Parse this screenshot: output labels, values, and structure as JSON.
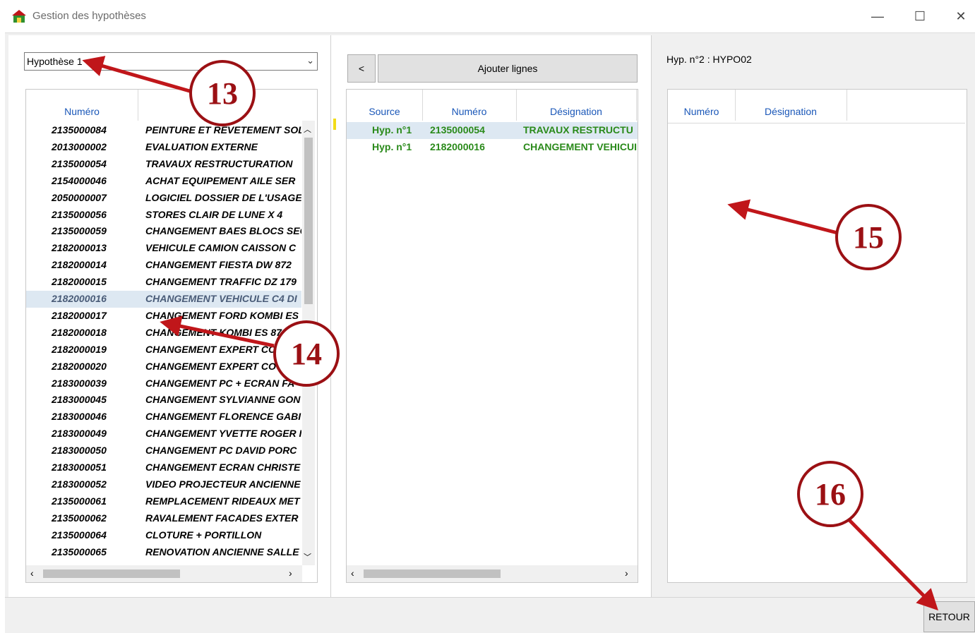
{
  "window": {
    "title": "Gestion des hypothèses",
    "minimize": "—",
    "maximize": "☐",
    "close": "✕"
  },
  "left": {
    "combo_value": "Hypothèse 1",
    "columns": [
      "Numéro",
      ""
    ],
    "rows": [
      [
        "2135000084",
        "PEINTURE ET REVETEMENT SOL"
      ],
      [
        "2013000002",
        "EVALUATION EXTERNE"
      ],
      [
        "2135000054",
        "TRAVAUX RESTRUCTURATION"
      ],
      [
        "2154000046",
        "ACHAT EQUIPEMENT AILE SER"
      ],
      [
        "2050000007",
        "LOGICIEL DOSSIER DE L'USAGE"
      ],
      [
        "2135000056",
        "STORES CLAIR DE LUNE X 4"
      ],
      [
        "2135000059",
        "CHANGEMENT BAES BLOCS SEC"
      ],
      [
        "2182000013",
        "VEHICULE CAMION CAISSON C"
      ],
      [
        "2182000014",
        "CHANGEMENT FIESTA DW 872"
      ],
      [
        "2182000015",
        "CHANGEMENT TRAFFIC DZ 179"
      ],
      [
        "2182000016",
        "CHANGEMENT VEHICULE C4 DI"
      ],
      [
        "2182000017",
        "CHANGEMENT FORD KOMBI ES"
      ],
      [
        "2182000018",
        "CHANGEMENT KOMBI ES 87"
      ],
      [
        "2182000019",
        "CHANGEMENT EXPERT CO"
      ],
      [
        "2182000020",
        "CHANGEMENT EXPERT CO"
      ],
      [
        "2183000039",
        "CHANGEMENT PC + ECRAN FA"
      ],
      [
        "2183000045",
        "CHANGEMENT SYLVIANNE GON"
      ],
      [
        "2183000046",
        "CHANGEMENT FLORENCE GABI"
      ],
      [
        "2183000049",
        "CHANGEMENT YVETTE ROGER I"
      ],
      [
        "2183000050",
        "CHANGEMENT PC DAVID PORC"
      ],
      [
        "2183000051",
        "CHANGEMENT ECRAN CHRISTE"
      ],
      [
        "2183000052",
        "VIDEO PROJECTEUR ANCIENNE"
      ],
      [
        "2135000061",
        "REMPLACEMENT RIDEAUX MET"
      ],
      [
        "2135000062",
        "RAVALEMENT FACADES EXTER"
      ],
      [
        "2135000064",
        "CLOTURE + PORTILLON"
      ],
      [
        "2135000065",
        "RENOVATION ANCIENNE SALLE"
      ]
    ],
    "selected_index": 10
  },
  "middle": {
    "back_label": "<",
    "add_label": "Ajouter lignes",
    "columns": [
      "Source",
      "Numéro",
      "Désignation"
    ],
    "rows": [
      [
        "Hyp. n°1",
        "2135000054",
        "TRAVAUX RESTRUCTU"
      ],
      [
        "Hyp. n°1",
        "2182000016",
        "CHANGEMENT VEHICUI"
      ]
    ]
  },
  "right": {
    "heading": "Hyp. n°2 : HYPO02",
    "columns": [
      "Numéro",
      "Désignation"
    ]
  },
  "footer": {
    "retour_label": "RETOUR"
  },
  "callouts": [
    "13",
    "14",
    "15",
    "16"
  ],
  "colors": {
    "header_text": "#1a57b8",
    "green_text": "#2a8a1a",
    "callout": "#9b1014",
    "selection": "#dde8f2"
  }
}
